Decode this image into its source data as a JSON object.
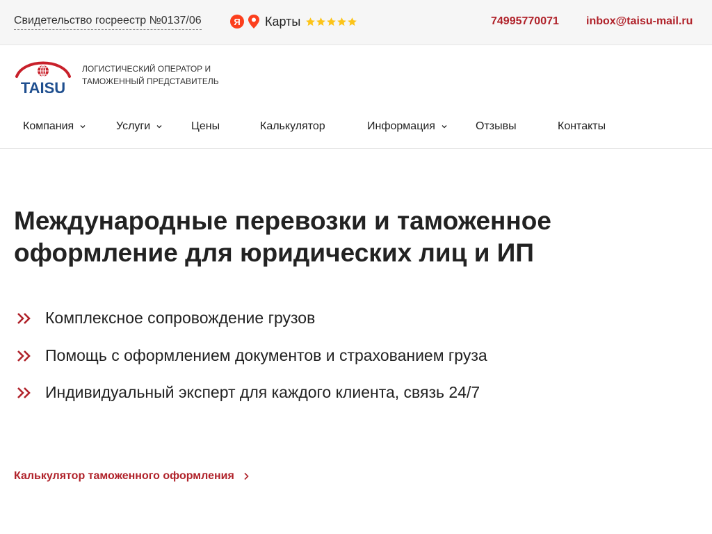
{
  "topbar": {
    "certificate": "Свидетельство госреестр №0137/06",
    "maps_brand_letter": "Я",
    "maps_label": "Карты",
    "rating_stars": 5,
    "phone": "74995770071",
    "email": "inbox@taisu-mail.ru"
  },
  "header": {
    "logo_text": "TAISU",
    "tagline_line1": "Логистический оператор и",
    "tagline_line2": "таможенный представитель"
  },
  "nav": {
    "items": [
      {
        "label": "Компания",
        "has_dropdown": true
      },
      {
        "label": "Услуги",
        "has_dropdown": true
      },
      {
        "label": "Цены",
        "has_dropdown": false
      },
      {
        "label": "Калькулятор",
        "has_dropdown": false
      },
      {
        "label": "Информация",
        "has_dropdown": true
      },
      {
        "label": "Отзывы",
        "has_dropdown": false
      },
      {
        "label": "Контакты",
        "has_dropdown": false
      }
    ]
  },
  "hero": {
    "title_line1": "Международные перевозки и таможенное",
    "title_line2": "оформление для юридических лиц и ИП",
    "benefits": [
      "Комплексное сопровождение грузов",
      "Помощь с оформлением документов и страхованием груза",
      "Индивидуальный эксперт для каждого клиента, связь 24/7"
    ],
    "calc_link": "Калькулятор таможенного оформления"
  },
  "colors": {
    "accent": "#b0222a",
    "topbar_bg": "#f6f6f6",
    "text": "#222222",
    "yandex_red": "#fc3f1d",
    "star": "#fcc419"
  },
  "icons": {
    "maps": [
      "yandex-icon",
      "map-pin-icon",
      "star-icon"
    ],
    "nav": "chevron-down-icon",
    "benefit": "double-chevron-right-icon",
    "link": "chevron-right-icon"
  }
}
